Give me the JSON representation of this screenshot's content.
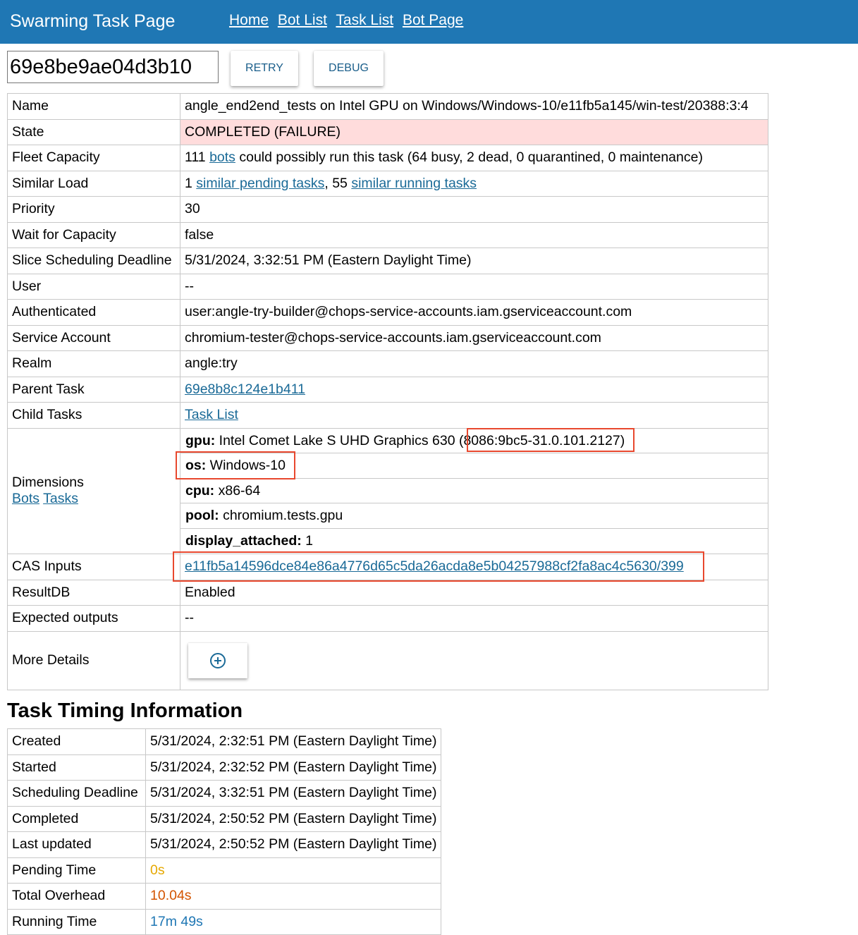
{
  "header": {
    "title": "Swarming Task Page",
    "nav": [
      "Home",
      "Bot List",
      "Task List",
      "Bot Page"
    ]
  },
  "toolbar": {
    "task_id": "69e8be9ae04d3b10",
    "retry_label": "RETRY",
    "debug_label": "DEBUG"
  },
  "details": {
    "name_label": "Name",
    "name_value": "angle_end2end_tests on Intel GPU on Windows/Windows-10/e11fb5a145/win-test/20388:3:4",
    "state_label": "State",
    "state_value": "COMPLETED (FAILURE)",
    "fleet_label": "Fleet Capacity",
    "fleet_count": "111",
    "fleet_bots_link": "bots",
    "fleet_rest": "could possibly run this task (64 busy, 2 dead, 0 quarantined, 0 maintenance)",
    "similar_label": "Similar Load",
    "similar_pending_count": "1",
    "similar_pending_link": "similar pending tasks",
    "similar_running_count": ", 55",
    "similar_running_link": "similar running tasks",
    "priority_label": "Priority",
    "priority_value": "30",
    "wait_label": "Wait for Capacity",
    "wait_value": "false",
    "slice_label": "Slice Scheduling Deadline",
    "slice_value": "5/31/2024, 3:32:51 PM (Eastern Daylight Time)",
    "user_label": "User",
    "user_value": "--",
    "auth_label": "Authenticated",
    "auth_value": "user:angle-try-builder@chops-service-accounts.iam.gserviceaccount.com",
    "service_label": "Service Account",
    "service_value": "chromium-tester@chops-service-accounts.iam.gserviceaccount.com",
    "realm_label": "Realm",
    "realm_value": "angle:try",
    "parent_label": "Parent Task",
    "parent_value": "69e8b8c124e1b411",
    "child_label": "Child Tasks",
    "child_value": "Task List",
    "dims_label": "Dimensions",
    "dims_bots_link": "Bots",
    "dims_tasks_link": "Tasks",
    "dimensions": [
      {
        "key": "gpu:",
        "value": "Intel Comet Lake S UHD Graphics 630 (8086:9bc5-31.0.101.2127)"
      },
      {
        "key": "os:",
        "value": "Windows-10"
      },
      {
        "key": "cpu:",
        "value": "x86-64"
      },
      {
        "key": "pool:",
        "value": "chromium.tests.gpu"
      },
      {
        "key": "display_attached:",
        "value": "1"
      }
    ],
    "cas_label": "CAS Inputs",
    "cas_value": "e11fb5a14596dce84e86a4776d65c5da26acda8e5b04257988cf2fa8ac4c5630/399",
    "resultdb_label": "ResultDB",
    "resultdb_value": "Enabled",
    "expected_label": "Expected outputs",
    "expected_value": "--",
    "more_label": "More Details"
  },
  "timing": {
    "title": "Task Timing Information",
    "rows": [
      {
        "label": "Created",
        "value": "5/31/2024, 2:32:51 PM (Eastern Daylight Time)"
      },
      {
        "label": "Started",
        "value": "5/31/2024, 2:32:52 PM (Eastern Daylight Time)"
      },
      {
        "label": "Scheduling Deadline",
        "value": "5/31/2024, 3:32:51 PM (Eastern Daylight Time)"
      },
      {
        "label": "Completed",
        "value": "5/31/2024, 2:50:52 PM (Eastern Daylight Time)"
      },
      {
        "label": "Last updated",
        "value": "5/31/2024, 2:50:52 PM (Eastern Daylight Time)"
      },
      {
        "label": "Pending Time",
        "value": "0s"
      },
      {
        "label": "Total Overhead",
        "value": "10.04s"
      },
      {
        "label": "Running Time",
        "value": "17m 49s"
      }
    ]
  },
  "colors": {
    "header_bg": "#1f77b4",
    "failure_bg": "#ffdcdc",
    "pending_time": "#e6a800",
    "overhead": "#d35400",
    "running_time": "#1f77b4",
    "highlight_box": "#e8482e"
  }
}
